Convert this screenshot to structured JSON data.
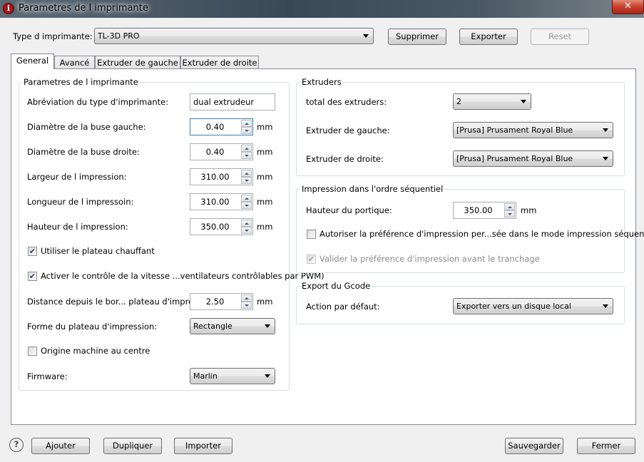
{
  "window": {
    "title": "Parametres de l imprimante",
    "close": "✕"
  },
  "header": {
    "printer_type_label": "Type d imprimante:",
    "printer_type_value": "TL-3D PRO",
    "delete": "Supprimer",
    "export": "Exporter",
    "reset": "Reset"
  },
  "tabs": [
    "General",
    "Avancé",
    "Extruder de gauche",
    "Extruder de droite"
  ],
  "printer": {
    "title": "Parametres de l imprimante",
    "abbr_label": "Abréviation du type d'imprimante:",
    "abbr_value": "dual extrudeur",
    "nozzle_left_label": "Diamètre de la buse gauche:",
    "nozzle_left_value": "0.40",
    "nozzle_right_label": "Diamètre de la buse droite:",
    "nozzle_right_value": "0.40",
    "width_label": "Largeur de l impression:",
    "width_value": "310.00",
    "length_label": "Longueur de l impressoin:",
    "length_value": "310.00",
    "height_label": "Hauteur de l impression:",
    "height_value": "350.00",
    "unit": "mm",
    "heated_bed_label": "Utiliser le plateau chauffant",
    "heated_bed_checked": true,
    "fan_label": "Activer le contrôle de la vitesse ...ventilateurs contrôlables par PWM)",
    "fan_checked": true,
    "distance_label": "Distance depuis le bor... plateau d'impression:",
    "distance_value": "2.50",
    "bed_shape_label": "Forme du plateau d'impression:",
    "bed_shape_value": "Rectangle",
    "origin_label": "Origine machine au centre",
    "origin_checked": false,
    "firmware_label": "Firmware:",
    "firmware_value": "Marlin"
  },
  "extruders": {
    "title": "Extruders",
    "total_label": "total des extruders:",
    "total_value": "2",
    "left_label": "Extruder de gauche:",
    "left_value": "[Prusa] Prusament Royal Blue",
    "right_label": "Extruder de droite:",
    "right_value": "[Prusa] Prusament Royal Blue"
  },
  "sequential": {
    "title": "Impression dans l'ordre séquentiel",
    "gantry_label": "Hauteur du portique:",
    "gantry_value": "350.00",
    "unit": "mm",
    "allow_label": "Autoriser la préférence d'impression per...sée dans le mode impression séquentielle",
    "allow_checked": false,
    "validate_label": "Valider la préférence d'impression avant le tranchage",
    "validate_checked": true
  },
  "gcode": {
    "title": "Export du Gcode",
    "action_label": "Action par défaut:",
    "action_value": "Exporter vers un disque local"
  },
  "footer": {
    "help": "?",
    "add": "Ajouter",
    "duplicate": "Dupliquer",
    "import": "Importer",
    "save": "Sauvegarder",
    "close": "Fermer"
  }
}
